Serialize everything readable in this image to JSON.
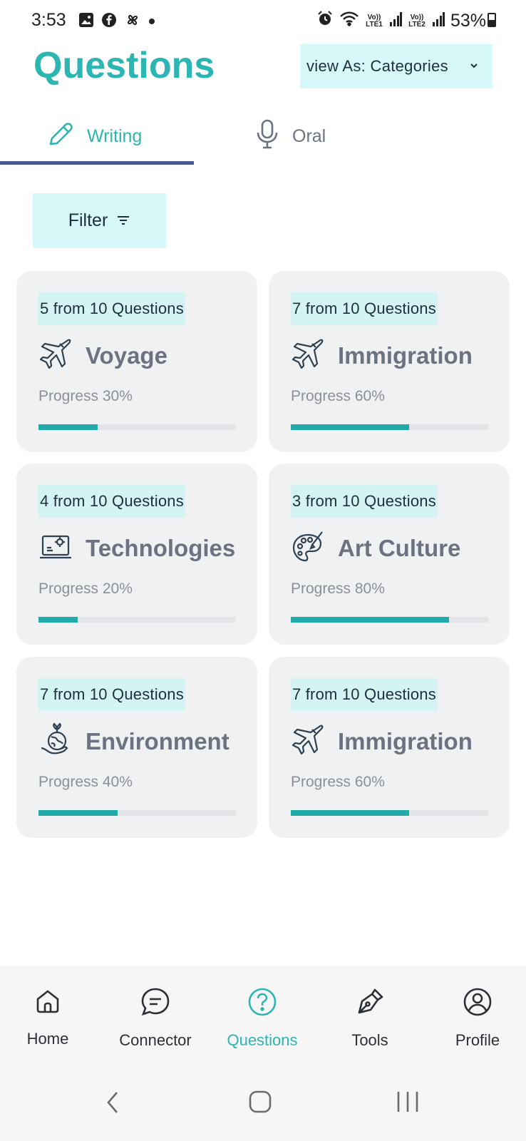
{
  "status_bar": {
    "time": "3:53",
    "battery": "53%",
    "battery_level": 0.53,
    "sim1_label": "Vo)) LTE1",
    "sim2_label": "Vo)) LTE2",
    "left_icons": [
      "gallery-icon",
      "facebook-icon",
      "pinwheel-icon",
      "dot-icon"
    ],
    "right_icons": [
      "alarm-icon",
      "wifi-icon",
      "signal-icon",
      "signal-icon",
      "battery-icon"
    ]
  },
  "header": {
    "title": "Questions",
    "view_as_label": "view As: Categories"
  },
  "tabs": [
    {
      "label": "Writing",
      "icon": "pencil-icon",
      "active": true
    },
    {
      "label": "Oral",
      "icon": "microphone-icon",
      "active": false
    }
  ],
  "filter": {
    "label": "Filter",
    "icon": "filter-icon"
  },
  "cards": [
    {
      "count_label": "5 from 10 Questions",
      "title": "Voyage",
      "icon": "airplane-icon",
      "progress_label": "Progress 30%",
      "progress": 0.3
    },
    {
      "count_label": "7 from 10 Questions",
      "title": "Immigration",
      "icon": "airplane-icon",
      "progress_label": "Progress 60%",
      "progress": 0.6
    },
    {
      "count_label": "4 from 10 Questions",
      "title": "Technologies",
      "icon": "laptop-gear-icon",
      "progress_label": "Progress 20%",
      "progress": 0.2
    },
    {
      "count_label": "3 from 10 Questions",
      "title": "Art Culture",
      "icon": "palette-icon",
      "progress_label": "Progress 80%",
      "progress": 0.8
    },
    {
      "count_label": "7 from 10 Questions",
      "title": "Environment",
      "icon": "globe-plant-icon",
      "progress_label": "Progress 40%",
      "progress": 0.4
    },
    {
      "count_label": "7 from 10 Questions",
      "title": "Immigration",
      "icon": "airplane-icon",
      "progress_label": "Progress 60%",
      "progress": 0.6
    }
  ],
  "bottom_nav": [
    {
      "label": "Home",
      "icon": "home-icon",
      "active": false
    },
    {
      "label": "Connector",
      "icon": "chat-icon",
      "active": false
    },
    {
      "label": "Questions",
      "icon": "question-icon",
      "active": true
    },
    {
      "label": "Tools",
      "icon": "pen-nib-icon",
      "active": false
    },
    {
      "label": "Profile",
      "icon": "user-icon",
      "active": false
    }
  ],
  "system_nav": [
    "back-icon",
    "home-circle-icon",
    "recents-icon"
  ],
  "colors": {
    "accent": "#2bb5b3",
    "chip_bg": "#d6f8f8",
    "card_bg": "#f0f1f3",
    "tab_underline": "#4a5a8c",
    "progress_fill": "#20aaa8"
  }
}
